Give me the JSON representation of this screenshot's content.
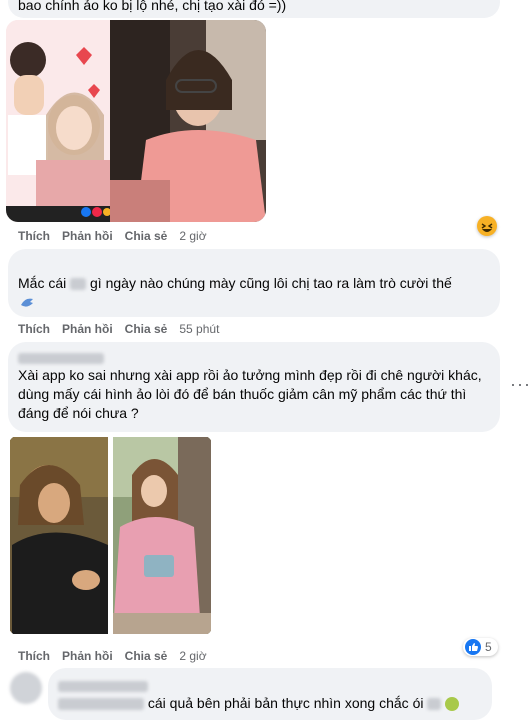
{
  "comment0": {
    "text_tail": "bao chính ảo ko bị lộ nhé, chị tạo xài đó =))"
  },
  "comment1": {
    "actions": {
      "like": "Thích",
      "reply": "Phản hồi",
      "share": "Chia sẻ",
      "time": "2 giờ"
    },
    "reaction_icon": "laughing-emoji-icon"
  },
  "comment2": {
    "text_prefix": "Mắc cái",
    "text_rest": "gì ngày nào chúng mày cũng lôi chị tao ra làm trò cười thế",
    "actions": {
      "like": "Thích",
      "reply": "Phản hồi",
      "share": "Chia sẻ",
      "time": "55 phút"
    }
  },
  "comment3": {
    "text": "Xài app ko sai nhưng xài app rồi ảo tưởng mình đẹp rồi đi chê người khác, dùng mấy cái hình ảo lòi đó để bán thuốc giảm cân mỹ phẩm các thứ thì đáng để nói chưa ?",
    "actions": {
      "like": "Thích",
      "reply": "Phản hồi",
      "share": "Chia sẻ",
      "time": "2 giờ"
    },
    "reaction_count": "5",
    "reaction_icon": "like-icon"
  },
  "comment4": {
    "text": "cái quả bên phải bản thực nhìn xong chắc ói"
  },
  "colors": {
    "bubble": "#f0f2f5",
    "secondary_text": "#65676b",
    "like_blue": "#1877f2"
  }
}
